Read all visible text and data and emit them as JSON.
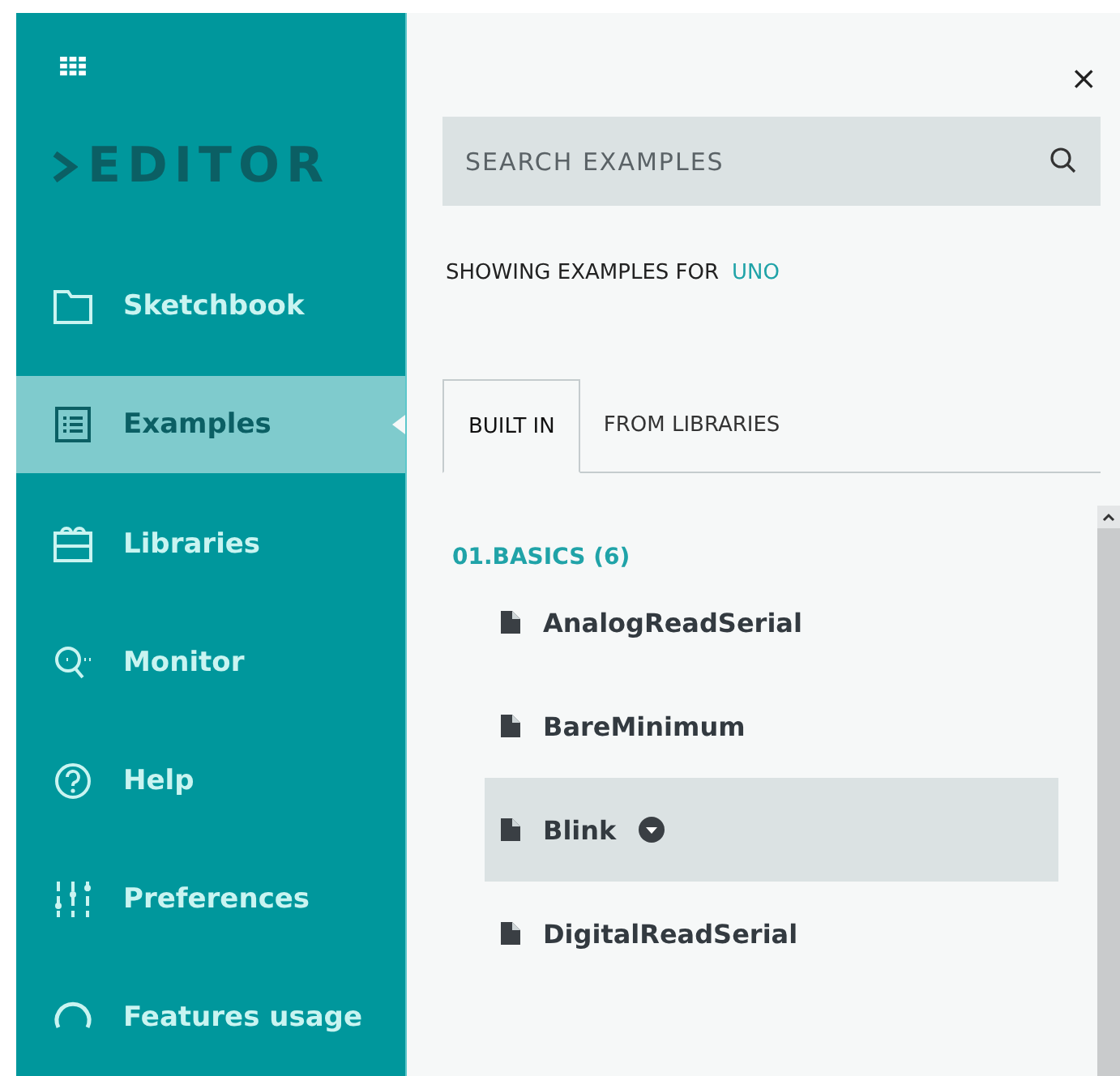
{
  "sidebar": {
    "logo": "EDITOR",
    "items": [
      {
        "label": "Sketchbook",
        "kind": "folder",
        "selected": false
      },
      {
        "label": "Examples",
        "kind": "list",
        "selected": true
      },
      {
        "label": "Libraries",
        "kind": "library",
        "selected": false
      },
      {
        "label": "Monitor",
        "kind": "monitor",
        "selected": false
      },
      {
        "label": "Help",
        "kind": "help",
        "selected": false
      },
      {
        "label": "Preferences",
        "kind": "sliders",
        "selected": false
      },
      {
        "label": "Features usage",
        "kind": "gauge",
        "selected": false
      }
    ]
  },
  "panel": {
    "close": "×",
    "search": {
      "placeholder": "SEARCH EXAMPLES"
    },
    "board_label": "SHOWING EXAMPLES FOR",
    "board": "UNO",
    "tabs": [
      {
        "label": "BUILT IN",
        "selected": true
      },
      {
        "label": "FROM LIBRARIES",
        "selected": false
      }
    ],
    "group": {
      "title": "01.BASICS (6)",
      "examples": [
        {
          "name": "AnalogReadSerial",
          "selected": false
        },
        {
          "name": "BareMinimum",
          "selected": false
        },
        {
          "name": "Blink",
          "selected": true
        },
        {
          "name": "DigitalReadSerial",
          "selected": false
        }
      ]
    }
  }
}
